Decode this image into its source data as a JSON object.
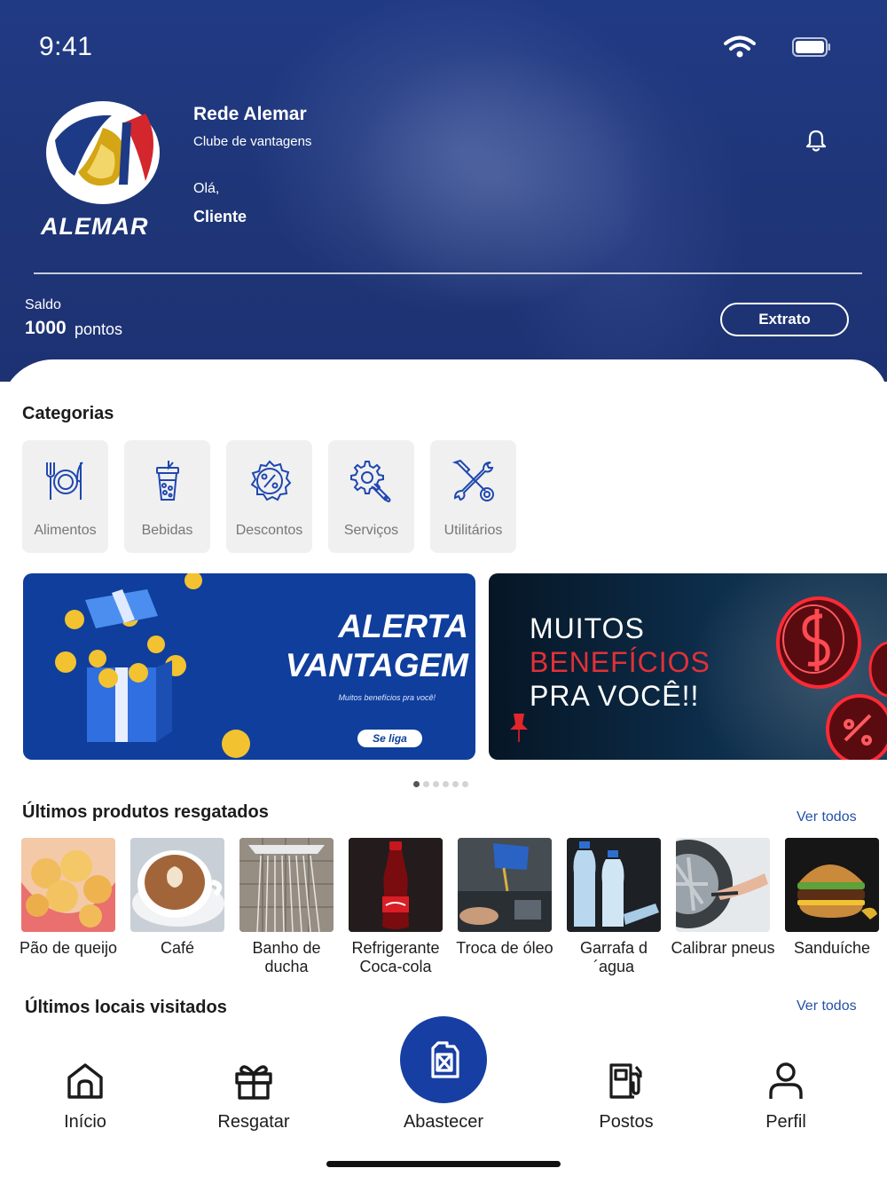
{
  "status_bar": {
    "time": "9:41"
  },
  "header": {
    "logo_text": "ALEMAR",
    "brand_name": "Rede Alemar",
    "brand_subtitle": "Clube de vantagens",
    "greeting": "Olá,",
    "user_name": "Cliente",
    "notification_icon": "bell-icon"
  },
  "balance": {
    "label": "Saldo",
    "value": "1000",
    "unit": "pontos",
    "statement_button": "Extrato"
  },
  "categories": {
    "title": "Categorias",
    "items": [
      {
        "label": "Alimentos",
        "icon": "cutlery-icon"
      },
      {
        "label": "Bebidas",
        "icon": "drink-cup-icon"
      },
      {
        "label": "Descontos",
        "icon": "discount-badge-icon"
      },
      {
        "label": "Serviços",
        "icon": "gear-wrench-icon"
      },
      {
        "label": "Utilitários",
        "icon": "tools-icon"
      }
    ]
  },
  "banners": [
    {
      "title_line1": "ALERTA",
      "title_line2": "VANTAGEM",
      "tagline": "Muitos benefícios pra você!",
      "button": "Se liga"
    },
    {
      "line1": "MUITOS",
      "line2": "BENEFÍCIOS",
      "line3": "PRA VOCÊ!!"
    }
  ],
  "carousel": {
    "dots": 6,
    "active_index": 0
  },
  "recent_products": {
    "title": "Últimos produtos resgatados",
    "see_all": "Ver todos",
    "items": [
      {
        "label": "Pão de queijo"
      },
      {
        "label": "Café"
      },
      {
        "label": "Banho de ducha"
      },
      {
        "label": "Refrigerante Coca-cola"
      },
      {
        "label": "Troca de óleo"
      },
      {
        "label": "Garrafa d´agua"
      },
      {
        "label": "Calibrar pneus"
      },
      {
        "label": "Sanduíche"
      }
    ]
  },
  "recent_places": {
    "title": "Últimos locais visitados",
    "see_all": "Ver todos"
  },
  "bottom_nav": {
    "items": [
      {
        "label": "Início",
        "icon": "home-icon"
      },
      {
        "label": "Resgatar",
        "icon": "gift-icon"
      },
      {
        "label": "Abastecer",
        "icon": "fuel-can-icon"
      },
      {
        "label": "Postos",
        "icon": "gas-station-icon"
      },
      {
        "label": "Perfil",
        "icon": "user-icon"
      }
    ]
  },
  "colors": {
    "primary_blue": "#173ea3",
    "header_blue": "#1e3577",
    "link_blue": "#2450a8",
    "accent_red": "#e23137"
  }
}
